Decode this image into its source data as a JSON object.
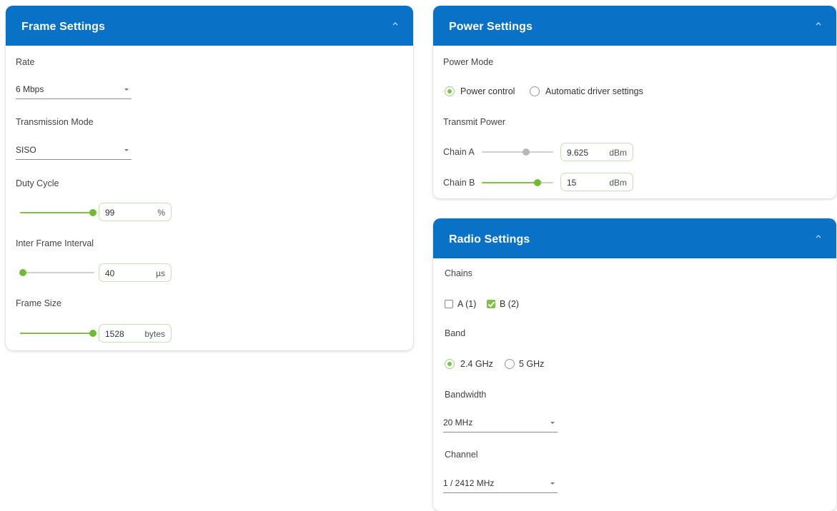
{
  "colors": {
    "header": "#0a72c6",
    "accent": "#7dc242"
  },
  "frame": {
    "title": "Frame Settings",
    "rate_label": "Rate",
    "rate_value": "6 Mbps",
    "tx_mode_label": "Transmission Mode",
    "tx_mode_value": "SISO",
    "duty_label": "Duty Cycle",
    "duty_value": "99",
    "duty_unit": "%",
    "duty_level": 1.0,
    "ifi_label": "Inter Frame Interval",
    "ifi_value": "40",
    "ifi_unit": "µs",
    "ifi_level": 0.0,
    "size_label": "Frame Size",
    "size_value": "1528",
    "size_unit": "bytes",
    "size_level": 1.0
  },
  "power": {
    "title": "Power Settings",
    "mode_label": "Power Mode",
    "mode_options": [
      "Power control",
      "Automatic driver settings"
    ],
    "mode_selected": "Power control",
    "tx_power_label": "Transmit Power",
    "chain_a_label": "Chain A",
    "chain_a_value": "9.625",
    "chain_a_unit": "dBm",
    "chain_a_level": 0.62,
    "chain_b_label": "Chain B",
    "chain_b_value": "15",
    "chain_b_unit": "dBm",
    "chain_b_level": 0.78
  },
  "radio": {
    "title": "Radio Settings",
    "chains_label": "Chains",
    "chain_a_opt": "A (1)",
    "chain_a_checked": false,
    "chain_b_opt": "B (2)",
    "chain_b_checked": true,
    "band_label": "Band",
    "band_options": [
      "2.4 GHz",
      "5 GHz"
    ],
    "band_selected": "2.4 GHz",
    "bandwidth_label": "Bandwidth",
    "bandwidth_value": "20 MHz",
    "channel_label": "Channel",
    "channel_value": "1 / 2412 MHz"
  }
}
